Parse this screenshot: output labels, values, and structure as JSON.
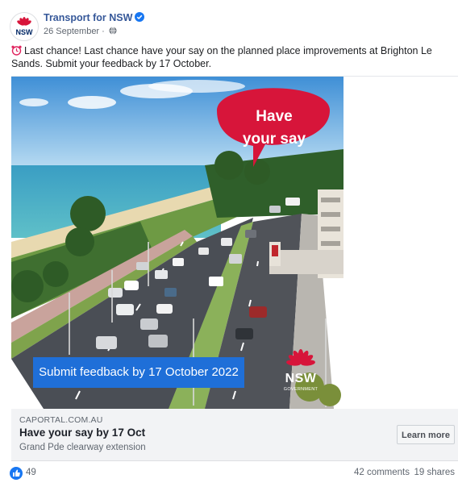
{
  "post": {
    "page_name": "Transport for NSW",
    "date": "26 September",
    "text": "Last chance! Last chance have your say on the planned place improvements at Brighton Le Sands. Submit your feedback by 17 October."
  },
  "image": {
    "bubble_line1": "Have",
    "bubble_line2": "your say",
    "banner": "Submit feedback by 17 October 2022",
    "logo_word": "NSW",
    "logo_sub": "GOVERNMENT"
  },
  "avatar": {
    "label": "NSW"
  },
  "link_preview": {
    "domain": "CAPORTAL.COM.AU",
    "title": "Have your say by 17 Oct",
    "description": "Grand Pde clearway extension",
    "button": "Learn more"
  },
  "stats": {
    "likes": "49",
    "comments": "42 comments",
    "shares": "19 shares"
  },
  "colors": {
    "brand_red": "#d7153a",
    "link_blue": "#365899",
    "banner_blue": "#1f6fd8",
    "like_blue": "#1877f2"
  },
  "icons": [
    "nsw-waratah-icon",
    "verified-badge-icon",
    "globe-icon",
    "alarm-clock-icon",
    "like-thumb-icon"
  ]
}
